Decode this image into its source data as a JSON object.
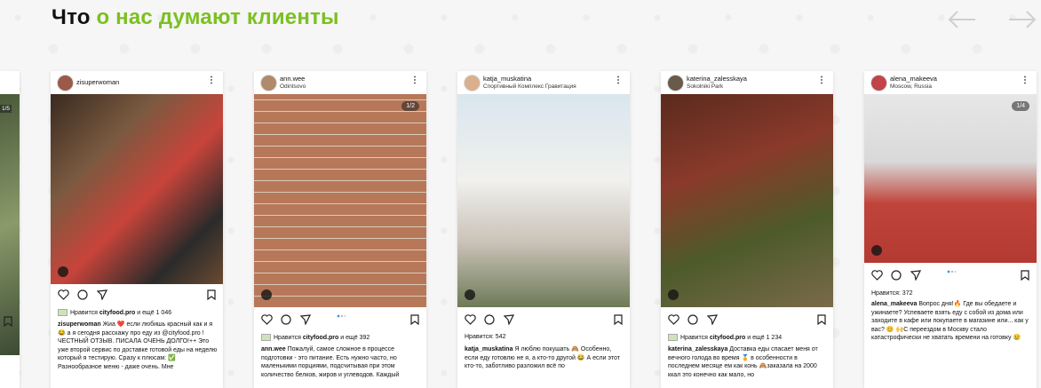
{
  "section": {
    "title_part1": "Что",
    "title_part2": "о нас думают клиенты",
    "colors": {
      "accent": "#7cc021",
      "dark": "#111111"
    }
  },
  "nav": {
    "prev_icon": "arrow-left-icon",
    "next_icon": "arrow-right-icon"
  },
  "edge_card": {
    "counter": "1/5"
  },
  "posts": [
    {
      "username": "zisuperwoman",
      "location": "",
      "counter": "",
      "likes_prefix": "Нравится",
      "likes_user": "cityfood.pro",
      "likes_suffix": "и ещё 1 046",
      "caption_user": "zisuperwoman",
      "caption_text": "Жиа ❤️ если любишь красный как и я😂 а я сегодня расскажу про еду из @cityfood.pro ! ЧЕСТНЫЙ ОТЗЫВ. ПИСАЛА ОЧЕНЬ ДОЛГО!++ Это уже второй сервис по доставке готовой еды на неделю который я тестирую. Сразу к плюсам: ✅ Разнообразное меню - даже очень. Мне"
    },
    {
      "username": "ann.wee",
      "location": "Odintsovo",
      "counter": "1/2",
      "likes_prefix": "Нравится",
      "likes_user": "cityfood.pro",
      "likes_suffix": "и ещё 392",
      "caption_user": "ann.wee",
      "caption_text": "Пожалуй, самое сложное в процессе подготовки - это питание. Есть нужно часто, но маленькими порциями, подсчитывая при этом количество белков, жиров и углеводов. Каждый"
    },
    {
      "username": "katja_muskatina",
      "location": "Спортивный Комплекс Гравитация",
      "counter": "",
      "likes_prefix": "Нравится:",
      "likes_user": "",
      "likes_suffix": "542",
      "caption_user": "katja_muskatina",
      "caption_text": "Я люблю покушать 🙈 Особенно, если еду готовлю не я, а кто-то другой 😂 А если этот кто-то, заботливо разложил всё по"
    },
    {
      "username": "katerina_zalesskaya",
      "location": "Sokolniki Park",
      "counter": "",
      "likes_prefix": "Нравится",
      "likes_user": "cityfood.pro",
      "likes_suffix": "и ещё 1 234",
      "caption_user": "katerina_zalesskaya",
      "caption_text": "Доставка еды спасает меня от вечного голода во время 🏅 в особенности в последнем месяце ем как конь 🙈заказала на 2000 ккал это конечно как мало, но"
    },
    {
      "username": "alena_makeeva",
      "location": "Moscow, Russia",
      "counter": "1/4",
      "likes_prefix": "Нравится:",
      "likes_user": "",
      "likes_suffix": "372",
      "caption_user": "alena_makeeva",
      "caption_text": "Вопрос дня!🔥 Где вы обедаете и ужинаете? Успеваете взять еду с собой из дома или заходите в кафе или покупаете в магазине или... как у вас? 😊 🙌С переездом в Москву стало катастрофически не хватать времени на готовку 😢"
    }
  ]
}
